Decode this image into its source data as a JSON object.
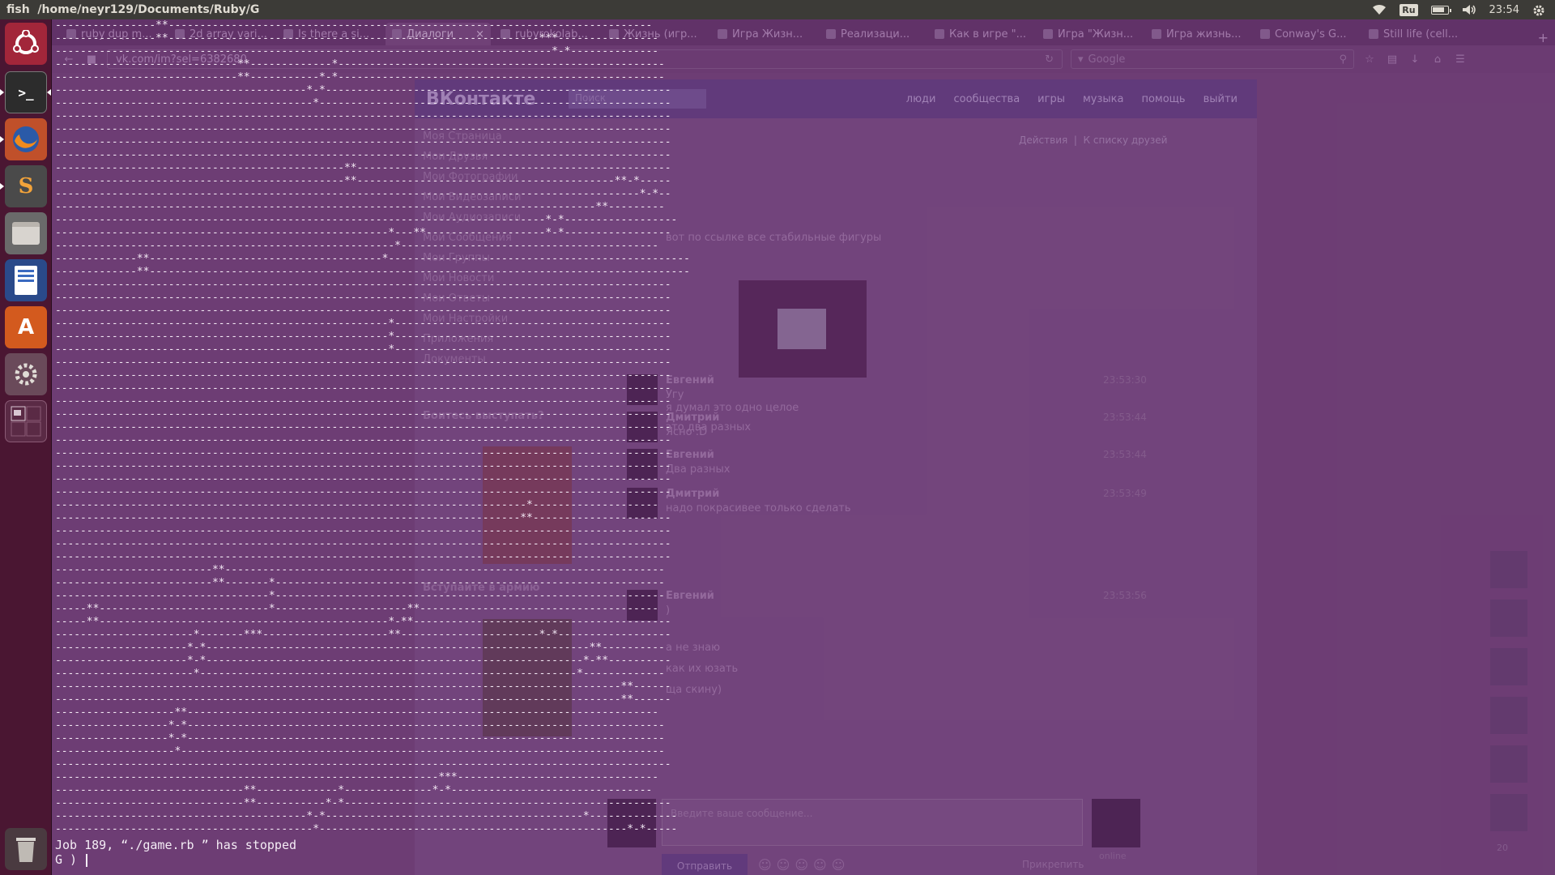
{
  "top_panel": {
    "window_title": "fish  /home/neyr129/Documents/Ruby/G",
    "lang": "Ru",
    "clock": "23:54"
  },
  "launcher": {
    "items": [
      "ubuntu-dash",
      "terminal",
      "firefox",
      "sublime-text",
      "file-manager",
      "writer",
      "software-center",
      "system-settings",
      "workspace-switcher",
      "trash"
    ]
  },
  "browser": {
    "tabs": [
      "ruby dup m...",
      "2d array vari...",
      "Is there a si...",
      "Диалоги",
      "rubyrokolab...",
      "Жизнь (игр...",
      "Игра Жизн...",
      "Реализаци...",
      "Как в игре \"...",
      "Игра \"Жизн...",
      "Игра жизнь...",
      "Conway's G...",
      "Still life (cell..."
    ],
    "url": "vk.com/im?sel=6382680",
    "search_placeholder": "Google",
    "vk": {
      "logo": "ВКонтакте",
      "search": "Поиск",
      "menu": [
        "люди",
        "сообщества",
        "игры",
        "музыка",
        "помощь",
        "выйти"
      ],
      "sidebar": [
        "Моя Страница",
        "Мои Друзья",
        "Мои Фотографии",
        "Мои Видеозаписи",
        "Мои Аудиозаписи",
        "Мои Сообщения",
        "Мои Группы",
        "Мои Новости",
        "Мои Ответы",
        "Мои Настройки",
        "Приложения",
        "Документы"
      ],
      "promo1": "Боитесь выступать?",
      "promo2": "Вступайте в армию",
      "dialog_links": [
        "Действия",
        "К списку друзей"
      ],
      "lines": [
        "вот по ссылке все стабильные фигуры",
        "я думал это одно целое",
        "это два разных"
      ],
      "messages": [
        {
          "name": "Евгений",
          "text": "Угу",
          "time": "23:53:30"
        },
        {
          "name": "Дмитрий",
          "text": "Ясно :D",
          "time": "23:53:44"
        },
        {
          "name": "Евгений",
          "text": "Два разных",
          "time": "23:53:44"
        },
        {
          "name": "Дмитрий",
          "text": "надо покрасивее только сделать",
          "time": "23:53:49"
        },
        {
          "name": "Евгений",
          "text": ")",
          "time": "23:53:56"
        }
      ],
      "extra_lines": [
        "а не знаю",
        "как их юзать",
        "ща скину)"
      ],
      "composer_placeholder": "Введите ваше сообщение...",
      "send_label": "Отправить",
      "attach_label": "Прикрепить",
      "online_label": "online",
      "friends_count": "20"
    }
  },
  "terminal": {
    "grid_rows": [
      "----------------**-----------------------------------------------------------------------------",
      "----------------**-----------------------------------------------------------***----------------",
      "-------------------------------------------------------------------------------*-*--------------",
      "-----------------------------**-------------*----------------------------------------------------",
      "-----------------------------**-----------*-*----------------------------------------------------",
      "----------------------------------------*-*-------------------------------------------------------",
      "-----------------------------------------*--------------------------------------------------------",
      "--------------------------------------------------------------------------------------------------",
      "--------------------------------------------------------------------------------------------------",
      "--------------------------------------------------------------------------------------------------",
      "--------------------------------------------------------------------------------------------------",
      "----------------------------------------------**--------------------------------------------------",
      "----------------------------------------------**-----------------------------------------**-*-----",
      "---------------------------------------------------------------------------------------------*-*--",
      "--------------------------------------------------------------------------------------**---------",
      "------------------------------------------------------------------------------*-*------------------",
      "-----------------------------------------------------*---**-------------------*-*-----------------",
      "------------------------------------------------------*-----------------------------------------",
      "-------------**-------------------------------------*------------------------------------------------",
      "-------------**--------------------------------------------------------------------------------------",
      "--------------------------------------------------------------------------------------------------",
      "--------------------------------------------------------------------------------------------------",
      "--------------------------------------------------------------------------------------------------",
      "-----------------------------------------------------*--------------------------------------------",
      "-----------------------------------------------------*--------------------------------------------",
      "-----------------------------------------------------*--------------------------------------------",
      "--------------------------------------------------------------------------------------------------",
      "--------------------------------------------------------------------------------------------------",
      "--------------------------------------------------------------------------------------------------",
      "--------------------------------------------------------------------------------------------------",
      "--------------------------------------------------------------------------------------------------",
      "--------------------------------------------------------------------------------------------------",
      "--------------------------------------------------------------------------------------------------",
      "--------------------------------------------------------------------------------------------------",
      "--------------------------------------------------------------------------------------------------",
      "--------------------------------------------------------------------------------------------------",
      "--------------------------------------------------------------------------------------------------",
      "---------------------------------------------------------------------------*--------------------",
      "--------------------------------------------------------------------------**----------------------",
      "--------------------------------------------------------------------------------------------------",
      "--------------------------------------------------------------------------------------------------",
      "--------------------------------------------------------------------------------------------------",
      "-------------------------**----------------------------------------------------------------------",
      "-------------------------**-------*--------------------------------------------------------------",
      "----------------------------------*--------------------------------------------------------------",
      "-----**---------------------------*---------------------**--------------------------------------",
      "-----**----------------------------------------------*-**-----------------------------------------",
      "----------------------*-------***--------------------**----------------------*-*------------------",
      "---------------------*-*-------------------------------------------------------------**----------",
      "---------------------*-*------------------------------------------------------------*-**----------",
      "----------------------*------------------------------------------------------------*-------------",
      "------------------------------------------------------------------------------------------**------",
      "------------------------------------------------------------------------------------------**------",
      "-------------------**---------------------------------------------------------------------------",
      "------------------*-*----------------------------------------------------------------------------",
      "------------------*-*----------------------------------------------------------------------------",
      "-------------------*-----------------------------------------------------------------------------",
      "--------------------------------------------------------------------------------------------------",
      "-------------------------------------------------------------***--------------------------------",
      "------------------------------**-------------*--------------*-*--------------------------------",
      "------------------------------**-----------*-*----------------------------------------------------",
      "----------------------------------------*-*-----------------------------------------*--------------",
      "-----------------------------------------*-------------------------------------------------*-*-----"
    ],
    "status_line_1": "Job 189, “./game.rb ” has stopped",
    "status_line_2": "G ) "
  }
}
